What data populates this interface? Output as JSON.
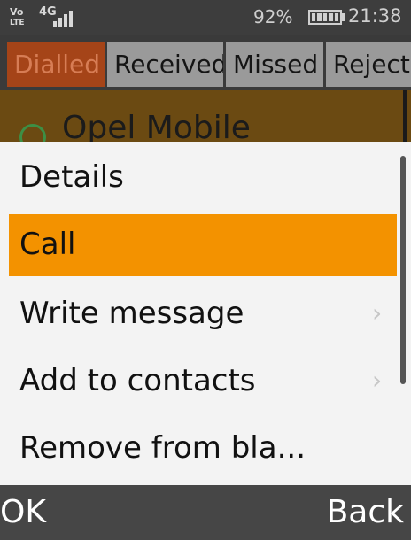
{
  "status_bar": {
    "volte_top": "Vo",
    "volte_bottom": "LTE",
    "network": "4G",
    "battery_percent": "92%",
    "time": "21:38",
    "icons": [
      "volte-icon",
      "signal-icon",
      "battery-icon"
    ]
  },
  "tabs": [
    {
      "label": "Dialled",
      "active": true
    },
    {
      "label": "Received",
      "active": false
    },
    {
      "label": "Missed",
      "active": false
    },
    {
      "label": "Reject",
      "active": false
    }
  ],
  "contact": {
    "name": "Opel Mobile",
    "icon": "outgoing-call-icon"
  },
  "menu": {
    "items": [
      {
        "label": "Details",
        "has_submenu": false,
        "selected": false
      },
      {
        "label": "Call",
        "has_submenu": false,
        "selected": true
      },
      {
        "label": "Write message",
        "has_submenu": true,
        "selected": false
      },
      {
        "label": "Add to contacts",
        "has_submenu": true,
        "selected": false
      },
      {
        "label": "Remove from bla...",
        "has_submenu": false,
        "selected": false
      }
    ],
    "submenu_arrow": "›"
  },
  "softkeys": {
    "left": "OK",
    "right": "Back"
  },
  "colors": {
    "highlight": "#f39200",
    "active_tab": "#a54418",
    "inactive_tab": "#9a9a9a"
  }
}
